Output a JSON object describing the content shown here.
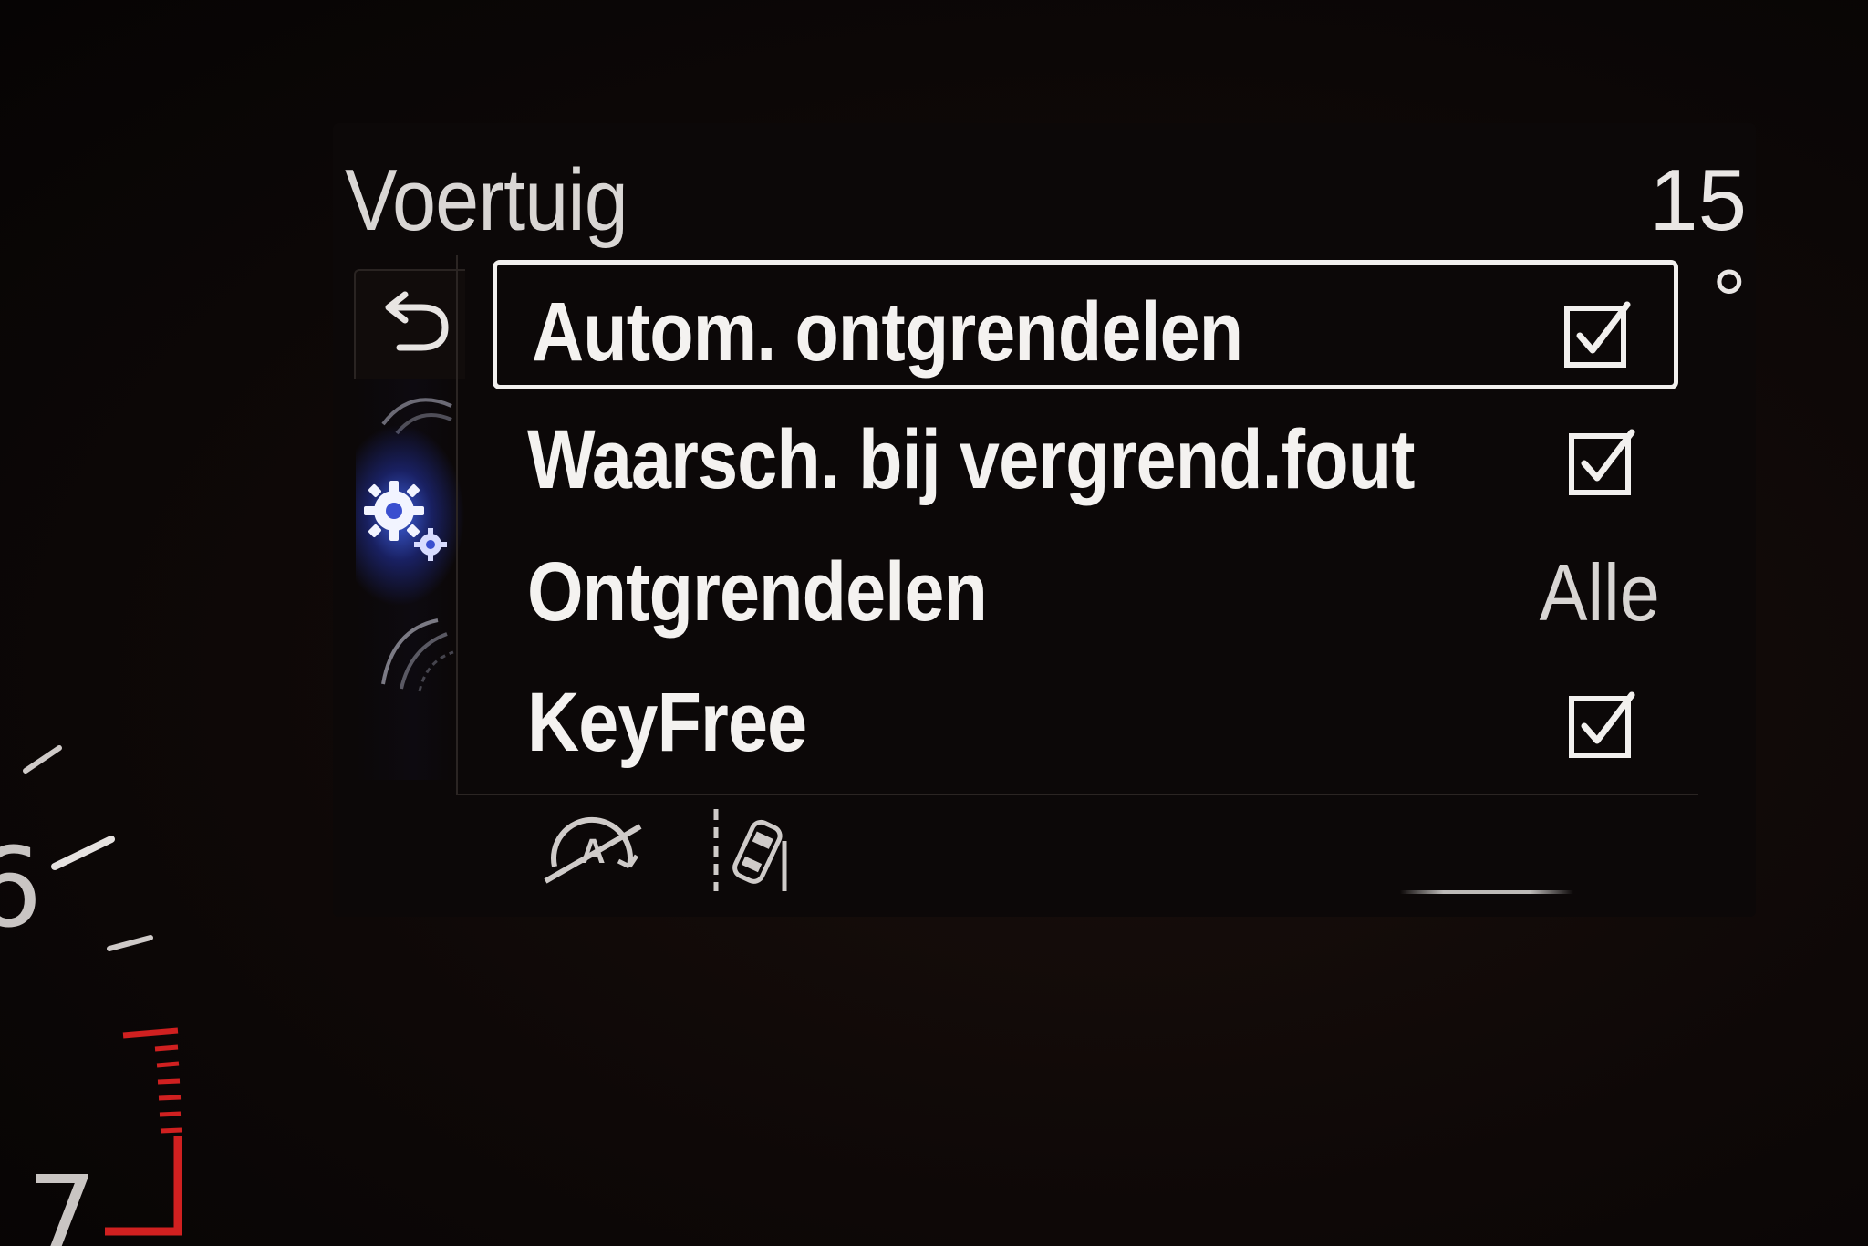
{
  "header": {
    "title": "Voertuig",
    "temperature": "15 °"
  },
  "menu": {
    "items": [
      {
        "label": "Autom. ontgrendelen",
        "control": "checkbox",
        "checked": true,
        "selected": true
      },
      {
        "label": "Waarsch. bij vergrend.fout",
        "control": "checkbox",
        "checked": true,
        "selected": false
      },
      {
        "label": "Ontgrendelen",
        "control": "value",
        "value": "Alle",
        "selected": false
      },
      {
        "label": "KeyFree",
        "control": "checkbox",
        "checked": true,
        "selected": false
      }
    ]
  },
  "sidebar": {
    "icons": [
      "back-arrow-icon",
      "settings-gears-icon"
    ],
    "active_accent": "#4a6cff"
  },
  "bottom_bar": {
    "icons": [
      "auto-start-stop-off-icon",
      "lane-keeping-icon"
    ]
  },
  "gauge": {
    "numbers": [
      "6",
      "7"
    ],
    "redline_color": "#d02020"
  }
}
